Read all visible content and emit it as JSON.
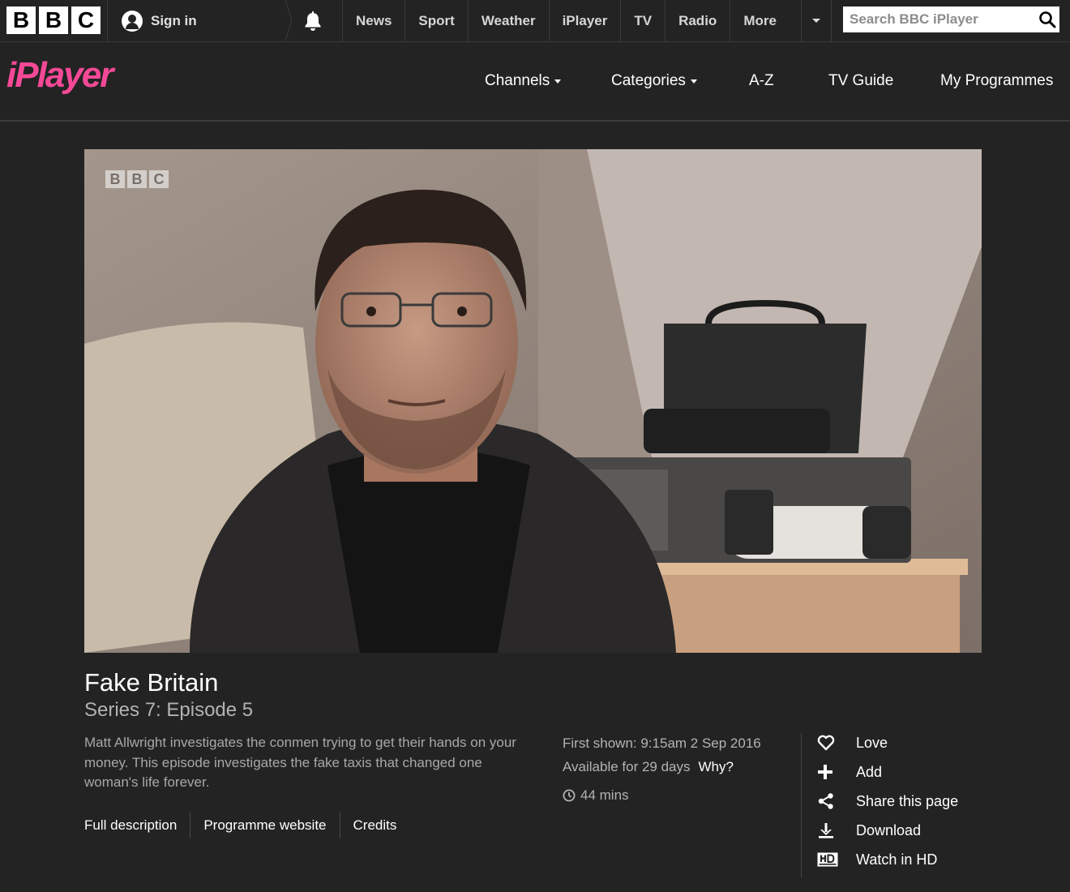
{
  "topbar": {
    "logo_letters": [
      "B",
      "B",
      "C"
    ],
    "signin_label": "Sign in",
    "nav": [
      "News",
      "Sport",
      "Weather",
      "iPlayer",
      "TV",
      "Radio",
      "More"
    ],
    "search_placeholder": "Search BBC iPlayer"
  },
  "iplayer": {
    "logo_text": "iPlayer",
    "nav": {
      "channels": "Channels",
      "categories": "Categories",
      "az": "A-Z",
      "tv_guide": "TV Guide",
      "my_programmes": "My Programmes"
    }
  },
  "video": {
    "watermark_letters": [
      "B",
      "B",
      "C"
    ]
  },
  "programme": {
    "title": "Fake Britain",
    "subtitle": "Series 7: Episode 5",
    "description": "Matt Allwright investigates the conmen trying to get their hands on your money. This episode investigates the fake taxis that changed one woman's life forever.",
    "links": [
      "Full description",
      "Programme website",
      "Credits"
    ],
    "first_shown": "First shown: 9:15am 2 Sep 2016",
    "available": "Available for 29 days",
    "why": "Why?",
    "duration": "44 mins"
  },
  "actions": [
    {
      "icon": "heart-icon",
      "label": "Love"
    },
    {
      "icon": "plus-icon",
      "label": "Add"
    },
    {
      "icon": "share-icon",
      "label": "Share this page"
    },
    {
      "icon": "download-icon",
      "label": "Download"
    },
    {
      "icon": "hd-icon",
      "label": "Watch in HD"
    }
  ],
  "colors": {
    "background": "#232323",
    "iplayer_pink": "#f54997",
    "muted_text": "#b3b3b3"
  }
}
